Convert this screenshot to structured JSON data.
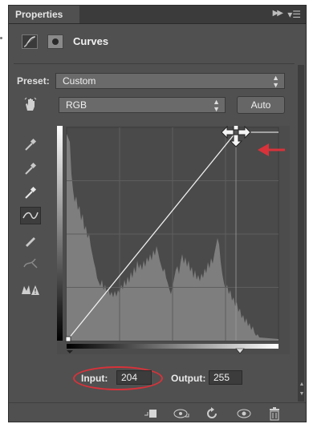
{
  "panel": {
    "tab_title": "Properties",
    "collapse_icon": "double-chevron-right-icon",
    "menu_icon": "panel-menu-icon"
  },
  "header": {
    "title": "Curves",
    "adjustment_icon": "curves-adjustment-icon",
    "mask_icon": "layer-mask-icon"
  },
  "preset": {
    "label": "Preset:",
    "value": "Custom"
  },
  "channel": {
    "value": "RGB"
  },
  "auto_button": "Auto",
  "tools": [
    "on-image-adjust-hand-icon",
    "black-point-eyedropper-icon",
    "gray-point-eyedropper-icon",
    "white-point-eyedropper-icon",
    "curve-points-icon",
    "pencil-draw-icon",
    "smooth-curve-icon",
    "clipping-warning-icon"
  ],
  "curve": {
    "input": "204",
    "output": "255"
  },
  "io": {
    "input_label": "Input:",
    "input_value": "204",
    "output_label": "Output:",
    "output_value": "255"
  },
  "bottom_icons": [
    "clip-to-layer-icon",
    "view-previous-state-icon",
    "reset-icon",
    "toggle-visibility-icon",
    "delete-icon"
  ],
  "colors": {
    "annotation_red": "#d8323a",
    "panel_bg": "#505050"
  }
}
